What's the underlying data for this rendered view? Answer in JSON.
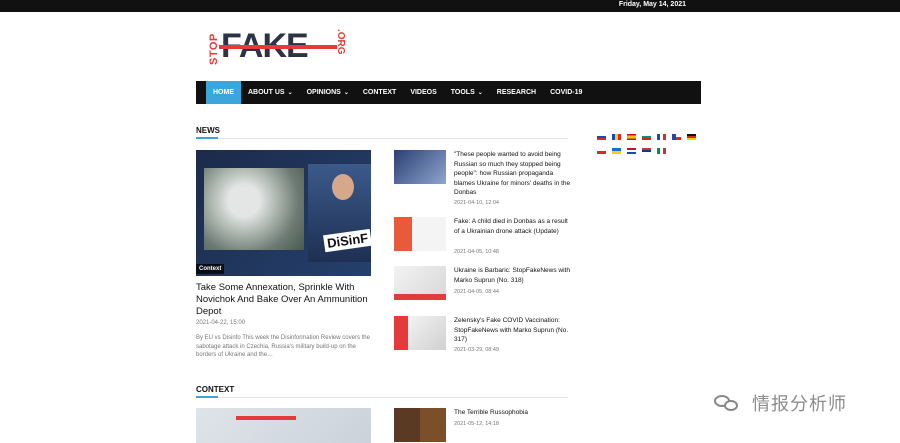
{
  "topbar": {
    "date": "Friday, May 14, 2021"
  },
  "logo": {
    "stop": "STOP",
    "fake": "FAKE",
    "org": ".ORG"
  },
  "nav": {
    "items": [
      {
        "label": "HOME",
        "active": true,
        "dropdown": false
      },
      {
        "label": "ABOUT US",
        "active": false,
        "dropdown": true
      },
      {
        "label": "OPINIONS",
        "active": false,
        "dropdown": true
      },
      {
        "label": "CONTEXT",
        "active": false,
        "dropdown": false
      },
      {
        "label": "VIDEOS",
        "active": false,
        "dropdown": false
      },
      {
        "label": "TOOLS",
        "active": false,
        "dropdown": true
      },
      {
        "label": "RESEARCH",
        "active": false,
        "dropdown": false
      },
      {
        "label": "COVID-19",
        "active": false,
        "dropdown": false
      }
    ]
  },
  "news": {
    "section_title": "NEWS",
    "featured": {
      "category": "Context",
      "image_text": "DiSinF",
      "title": "Take Some Annexation, Sprinkle With Novichok And Bake Over An Ammunition Depot",
      "date": "2021-04-22, 15:00",
      "excerpt": "By EU vs Disinfo This week the Disinformation Review covers the sabotage attack in Czechia, Russia's military build-up on the borders of Ukraine and the…"
    },
    "items": [
      {
        "title": "\"These people wanted to avoid being Russian so much they stopped being people\": how Russian propaganda blames Ukraine for minors' deaths in the Donbas",
        "date": "2021-04-10, 12:04"
      },
      {
        "title": "Fake: A child died in Donbas as a result of a Ukrainian drone attack (Update)",
        "date": "2021-04-05, 10:48"
      },
      {
        "title": "Ukraine is Barbaric: StopFakeNews with Marko Suprun (No. 318)",
        "date": "2021-04-05, 08:44"
      },
      {
        "title": "Zelensky's Fake COVID Vaccination: StopFakeNews with Marko Suprun (No. 317)",
        "date": "2021-03-29, 08:49"
      }
    ]
  },
  "context": {
    "section_title": "CONTEXT",
    "items": [
      {
        "title": "The Terrible Russophobia",
        "date": "2021-05-12, 14:18"
      }
    ]
  },
  "languages": [
    "ru",
    "ro",
    "es",
    "bg",
    "fr",
    "cz",
    "de",
    "pl",
    "ua",
    "nl",
    "rs",
    "it"
  ],
  "watermark": {
    "text": "情报分析师"
  },
  "colors": {
    "accent": "#3aa6dc",
    "brand_red": "#e23b3b",
    "nav_bg": "#111111"
  }
}
